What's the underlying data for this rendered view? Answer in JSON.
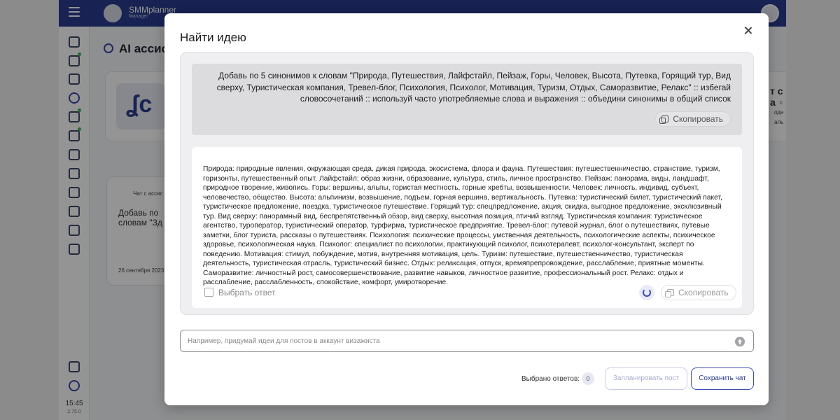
{
  "app": {
    "brand_name": "SMMplanner",
    "brand_role": "Manager",
    "page_title": "AI ассист",
    "time": "15:45",
    "version": "2.75.0",
    "bg_card_text_1": "Добавь по",
    "bg_card_text_2": "словам \"Зд",
    "bg_chip": "Чат с ассис",
    "bg_date": "26 сентября 2023",
    "bg_right_1": "т с а",
    "bg_right_2": "с",
    "bg_right_3": "одн",
    "bg_right_4": "аль"
  },
  "modal": {
    "title": "Найти идею",
    "prompt_text": "Добавь по 5 синонимов к словам \"Природа, Путешествия, Лайфстайл, Пейзаж, Горы, Человек, Высота, Путевка, Горящий тур, Вид сверху, Туристическая компания, Тревел-блог, Психология, Психолог, Мотивация, Туризм, Отдых, Саморазвитие, Релакс\" :: избегай словосочетаний :: используй часто употребляемые слова и выражения :: объедини синонимы в общий список",
    "copy_label": "Скопировать",
    "answer_text": "Природа: природные явления, окружающая среда, дикая природа, экосистема, флора и фауна. Путешествия: путешественничество, странствие, туризм, горизонты, путешественный опыт. Лайфстайл: образ жизни, образование, культура, стиль, личное пространство. Пейзаж: панорама, виды, ландшафт, природное творение, живопись. Горы: вершины, альпы, гористая местность, горные хребты, возвышенности. Человек: личность, индивид, субъект, человечество, общество. Высота: альпинизм, возвышение, подъем, горная вершина, вертикальность. Путевка: туристический билет, туристический пакет, туристическое предложение, поездка, туристическое путешествие. Горящий тур: спецпредложение, акция, скидка, выгодное предложение, эксклюзивный тур. Вид сверху: панорамный вид, беспрепятственный обзор, вид сверху, высотная позиция, птичий взгляд. Туристическая компания: туристическое агентство, туроператор, туристический оператор, турфирма, туристическое предприятие. Тревел-блог: путевой журнал, блог о путешествиях, путевые заметки, блог туриста, рассказы о путешествиях. Психология: психические процессы, умственная деятельность, психологические аспекты, психическое здоровье, психологическая наука. Психолог: специалист по психологии, практикующий психолог, психотерапевт, психолог-консультант, эксперт по поведению. Мотивация: стимул, побуждение, мотив, внутренняя мотивация, цель. Туризм: путешествие, путешественничество, туристическая деятельность, туристическая отрасль, туристический бизнес. Отдых: релаксация, отпуск, времяпрепровождение, расслабление, приятные моменты. Саморазвитие: личностный рост, самосовершенствование, развитие навыков, личностное развитие, профессиональный рост. Релакс: отдых и расслабление, расслабленность, спокойствие, комфорт, умиротворение.",
    "select_answer_label": "Выбрать ответ",
    "input_placeholder": "Например, придумай идеи для постов в аккаунт визажиста",
    "selected_label": "Выбрано ответов:",
    "selected_count": "0",
    "plan_button": "Запланировать пост",
    "save_button": "Сохранить чат"
  },
  "colors": {
    "brand": "#2a3c8f",
    "accent": "#3d4cb0",
    "status_green": "#3fb34f"
  }
}
